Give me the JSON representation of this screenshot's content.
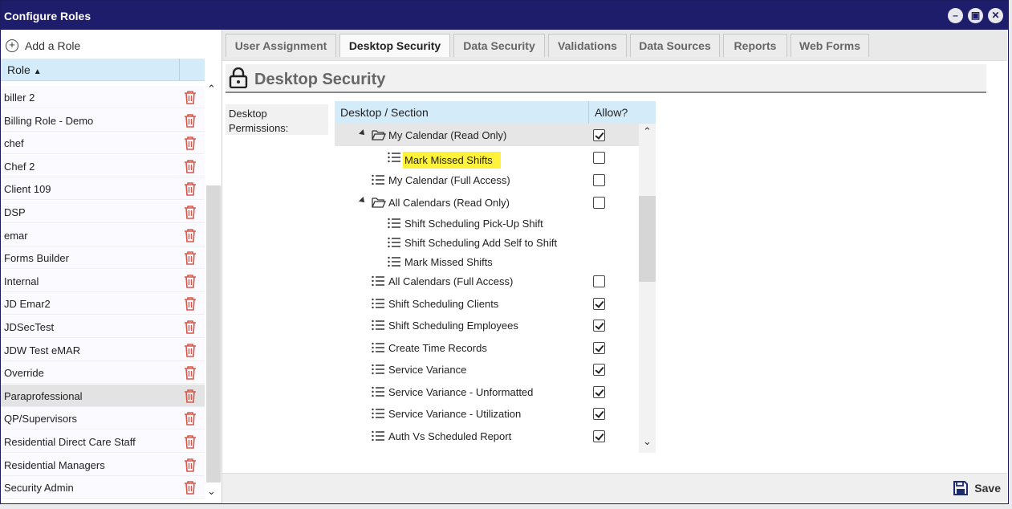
{
  "window": {
    "title": "Configure Roles",
    "controls": [
      "minimize-icon",
      "restore-icon",
      "close-icon"
    ]
  },
  "left_panel": {
    "add_role_label": "Add a Role",
    "column_header": "Role",
    "roles": [
      "biller 2",
      "Billing Role - Demo",
      "chef",
      "Chef 2",
      "Client 109",
      "DSP",
      "emar",
      "Forms Builder",
      "Internal",
      "JD Emar2",
      "JDSecTest",
      "JDW Test eMAR",
      "Override",
      "Paraprofessional",
      "QP/Supervisors",
      "Residential Direct Care Staff",
      "Residential Managers",
      "Security Admin"
    ],
    "selected_role": "Paraprofessional"
  },
  "tabs": [
    "User Assignment",
    "Desktop Security",
    "Data Security",
    "Validations",
    "Data Sources",
    "Reports",
    "Web Forms"
  ],
  "active_tab": "Desktop Security",
  "section": {
    "title": "Desktop Security",
    "permissions_label": "Desktop Permissions:"
  },
  "grid": {
    "col_section": "Desktop / Section",
    "col_allow": "Allow?",
    "rows": [
      {
        "label": "My Calendar (Read Only)",
        "type": "folder",
        "level": 1,
        "expanded": true,
        "checkbox": true,
        "checked": true,
        "selected": true
      },
      {
        "label": "Mark Missed Shifts",
        "type": "item",
        "level": 2,
        "checkbox": true,
        "checked": false,
        "highlighted": true
      },
      {
        "label": "My Calendar (Full Access)",
        "type": "item",
        "level": 1,
        "checkbox": true,
        "checked": false
      },
      {
        "label": "All Calendars (Read Only)",
        "type": "folder",
        "level": 1,
        "expanded": true,
        "checkbox": true,
        "checked": false
      },
      {
        "label": "Shift Scheduling Pick-Up Shift",
        "type": "item",
        "level": 2,
        "checkbox": false
      },
      {
        "label": "Shift Scheduling Add Self to Shift",
        "type": "item",
        "level": 2,
        "checkbox": false
      },
      {
        "label": "Mark Missed Shifts",
        "type": "item",
        "level": 2,
        "checkbox": false
      },
      {
        "label": "All Calendars (Full Access)",
        "type": "item",
        "level": 1,
        "checkbox": true,
        "checked": false
      },
      {
        "label": "Shift Scheduling Clients",
        "type": "item",
        "level": 1,
        "checkbox": true,
        "checked": true
      },
      {
        "label": "Shift Scheduling Employees",
        "type": "item",
        "level": 1,
        "checkbox": true,
        "checked": true
      },
      {
        "label": "Create Time Records",
        "type": "item",
        "level": 1,
        "checkbox": true,
        "checked": true
      },
      {
        "label": "Service Variance",
        "type": "item",
        "level": 1,
        "checkbox": true,
        "checked": true
      },
      {
        "label": "Service Variance - Unformatted",
        "type": "item",
        "level": 1,
        "checkbox": true,
        "checked": true
      },
      {
        "label": "Service Variance - Utilization",
        "type": "item",
        "level": 1,
        "checkbox": true,
        "checked": true
      },
      {
        "label": "Auth Vs Scheduled Report",
        "type": "item",
        "level": 1,
        "checkbox": true,
        "checked": true
      }
    ]
  },
  "footer": {
    "save_label": "Save"
  },
  "colors": {
    "titlebar": "#1e1d6b",
    "header_blue": "#d4ebfa",
    "highlight": "#fff23a",
    "trash": "#d9574a"
  }
}
